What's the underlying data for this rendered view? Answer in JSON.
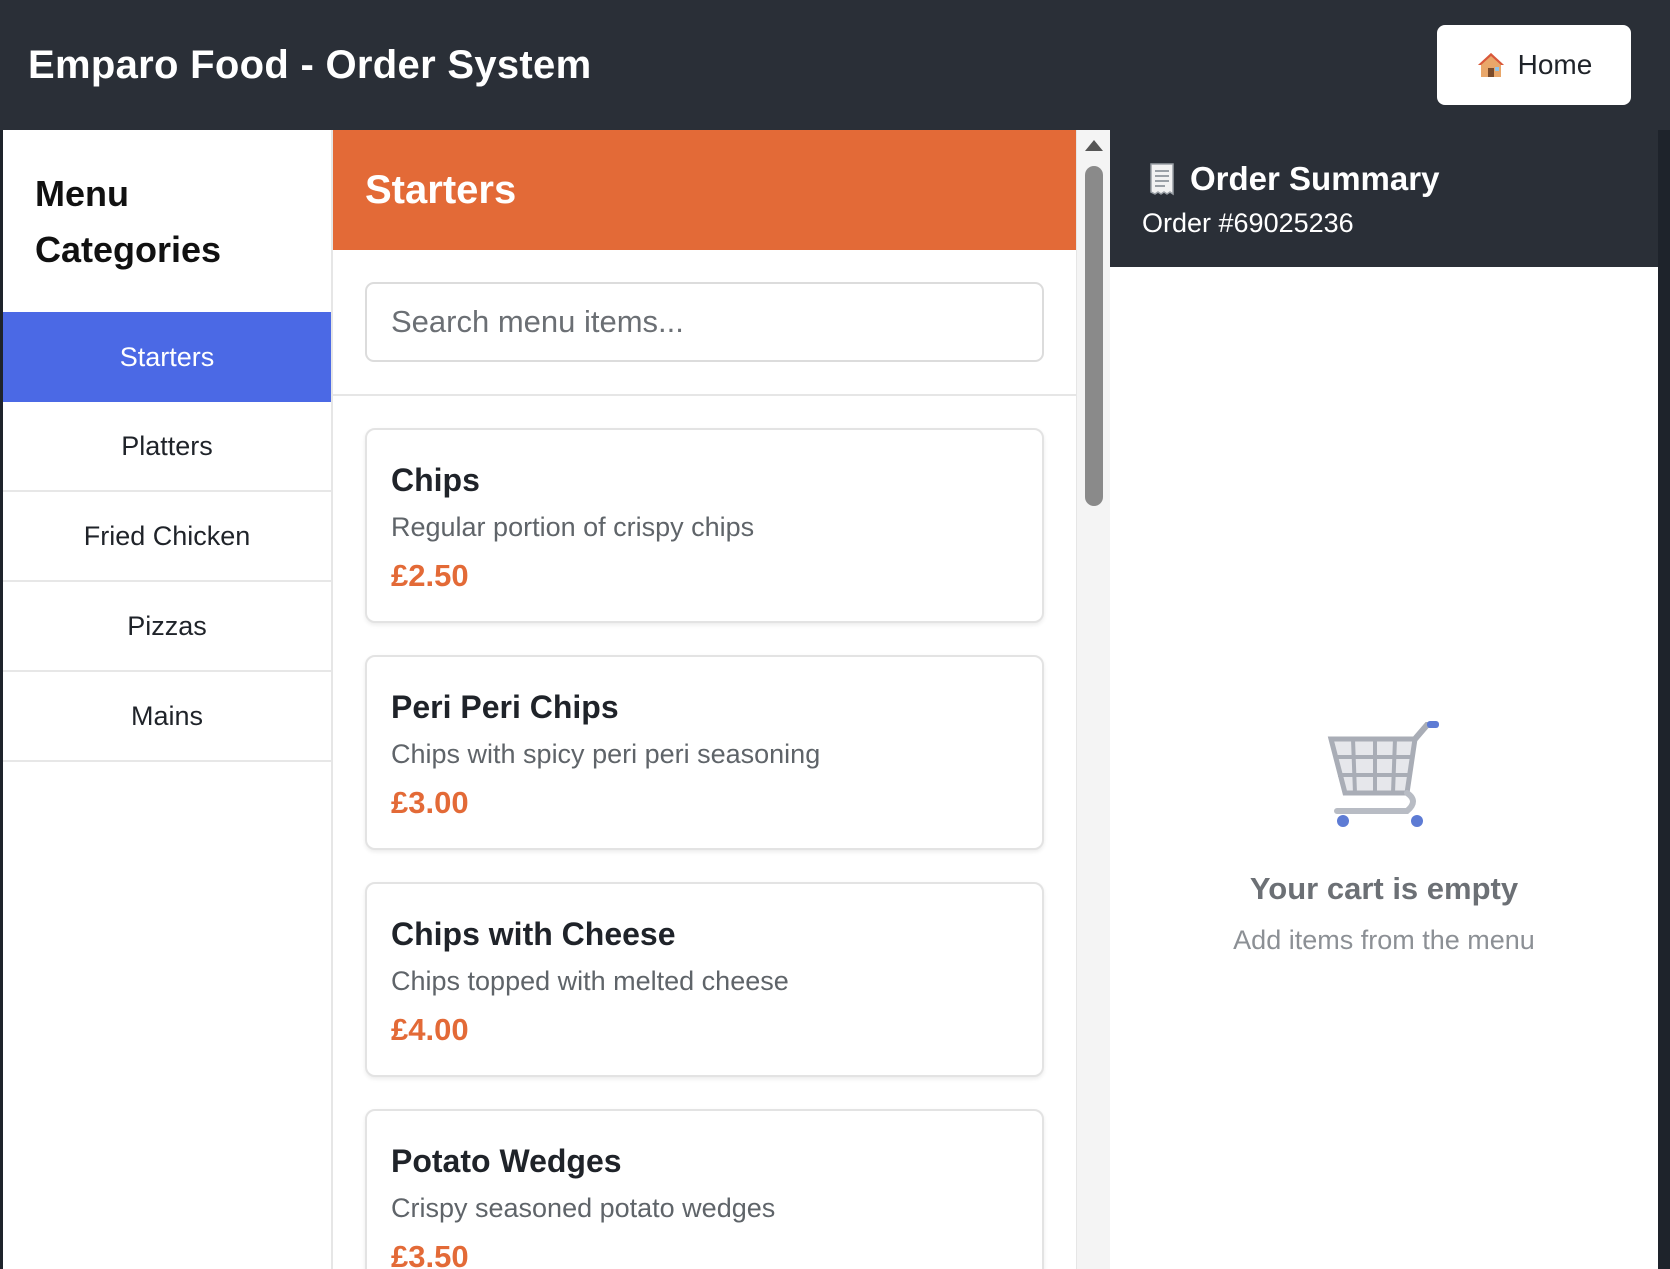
{
  "header": {
    "title": "Emparo Food - Order System",
    "home_button": {
      "label": "Home",
      "icon": "house-icon"
    }
  },
  "sidebar": {
    "heading": "Menu Categories",
    "items": [
      {
        "label": "Starters",
        "active": true
      },
      {
        "label": "Platters",
        "active": false
      },
      {
        "label": "Fried Chicken",
        "active": false
      },
      {
        "label": "Pizzas",
        "active": false
      },
      {
        "label": "Mains",
        "active": false
      }
    ]
  },
  "menu": {
    "category_title": "Starters",
    "search": {
      "placeholder": "Search menu items...",
      "value": ""
    },
    "items": [
      {
        "name": "Chips",
        "description": "Regular portion of crispy chips",
        "price": "£2.50"
      },
      {
        "name": "Peri Peri Chips",
        "description": "Chips with spicy peri peri seasoning",
        "price": "£3.00"
      },
      {
        "name": "Chips with Cheese",
        "description": "Chips topped with melted cheese",
        "price": "£4.00"
      },
      {
        "name": "Potato Wedges",
        "description": "Crispy seasoned potato wedges",
        "price": "£3.50"
      }
    ]
  },
  "summary": {
    "title": "Order Summary",
    "title_icon": "receipt-icon",
    "order_number": "Order #69025236",
    "empty": {
      "icon": "shopping-cart-icon",
      "title": "Your cart is empty",
      "subtitle": "Add items from the menu"
    }
  },
  "colors": {
    "header_bg": "#2a2f37",
    "accent_orange": "#e36a37",
    "active_blue": "#4b69e5"
  }
}
